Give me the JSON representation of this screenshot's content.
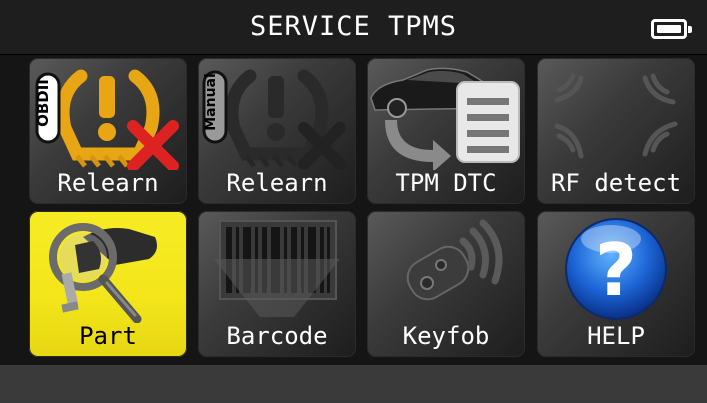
{
  "header": {
    "title": "SERVICE TPMS",
    "battery_icon": "battery-full-icon"
  },
  "tiles": [
    {
      "label": "Relearn",
      "icon": "obdii-relearn-icon",
      "badge": "OBDII"
    },
    {
      "label": "Relearn",
      "icon": "manual-relearn-icon",
      "badge": "Manual"
    },
    {
      "label": "TPM DTC",
      "icon": "car-dtc-icon"
    },
    {
      "label": "RF detect",
      "icon": "rf-signal-icon"
    },
    {
      "label": "Part",
      "icon": "tpms-sensor-magnifier-icon",
      "selected": true
    },
    {
      "label": "Barcode",
      "icon": "barcode-icon"
    },
    {
      "label": "Keyfob",
      "icon": "keyfob-icon"
    },
    {
      "label": "HELP",
      "icon": "help-question-icon"
    }
  ],
  "colors": {
    "selected_tile": "#f3e51a",
    "background": "#151515",
    "footer": "#3a3a3a"
  }
}
